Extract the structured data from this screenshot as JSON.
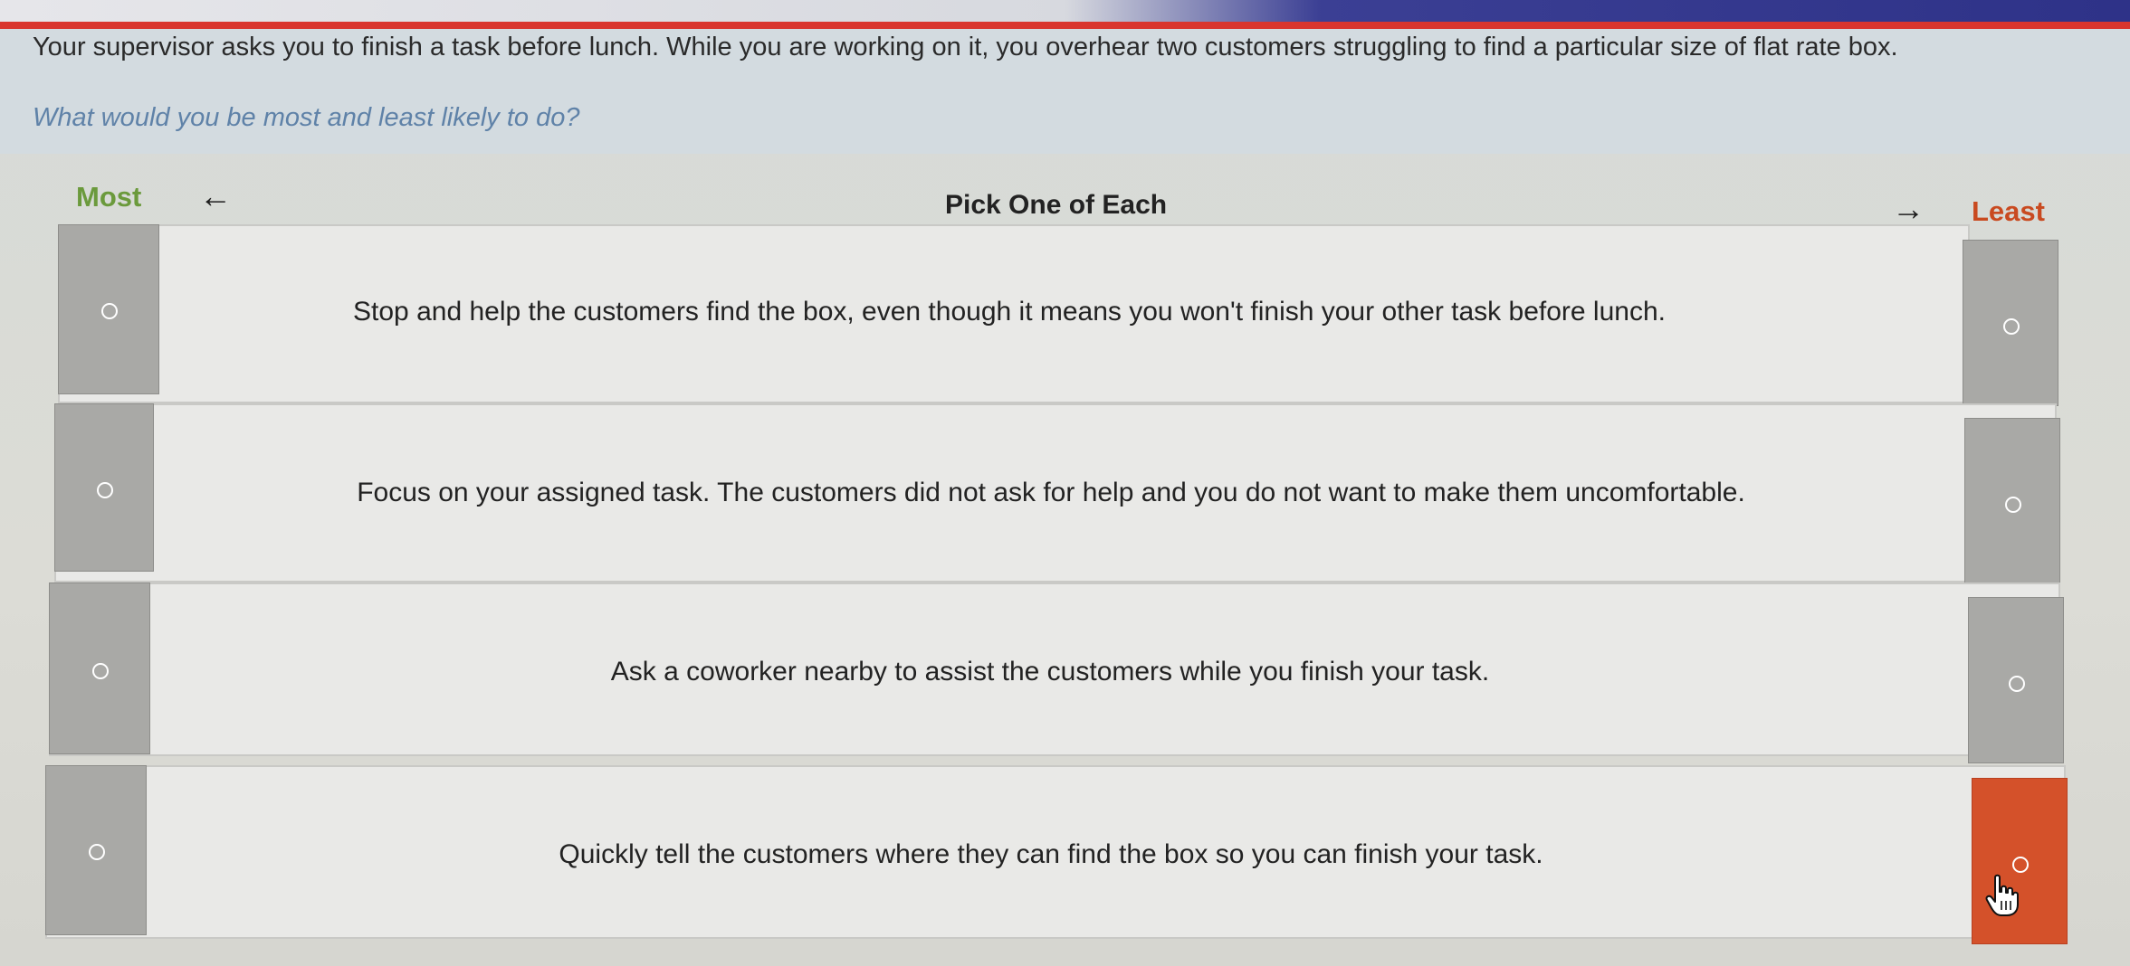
{
  "prompt": {
    "scenario": "Your supervisor asks you to finish a task before lunch. While you are working on it, you overhear two customers struggling to find a particular size of flat rate box.",
    "question": "What would you be most and least likely to do?"
  },
  "header": {
    "most_label": "Most",
    "least_label": "Least",
    "instruction": "Pick One of Each",
    "left_arrow": "←",
    "right_arrow": "→"
  },
  "options": [
    {
      "text": "Stop and help the customers find the box, even though it means you won't finish your other task before lunch.",
      "most_selected": false,
      "least_selected": false
    },
    {
      "text": "Focus on your assigned task. The customers did not ask for help and you do not want to make them uncomfortable.",
      "most_selected": false,
      "least_selected": false
    },
    {
      "text": "Ask a coworker nearby to assist the customers while you finish your task.",
      "most_selected": false,
      "least_selected": false
    },
    {
      "text": "Quickly tell the customers where they can find the box so you can finish your task.",
      "most_selected": false,
      "least_selected": true
    }
  ],
  "colors": {
    "most": "#6b9a3c",
    "least": "#c94a20",
    "selected_least": "#d4512a",
    "cell_gray": "#a9a9a6"
  },
  "icons": {
    "cursor": "hand-pointer-icon",
    "radio": "radio-circle-icon"
  }
}
